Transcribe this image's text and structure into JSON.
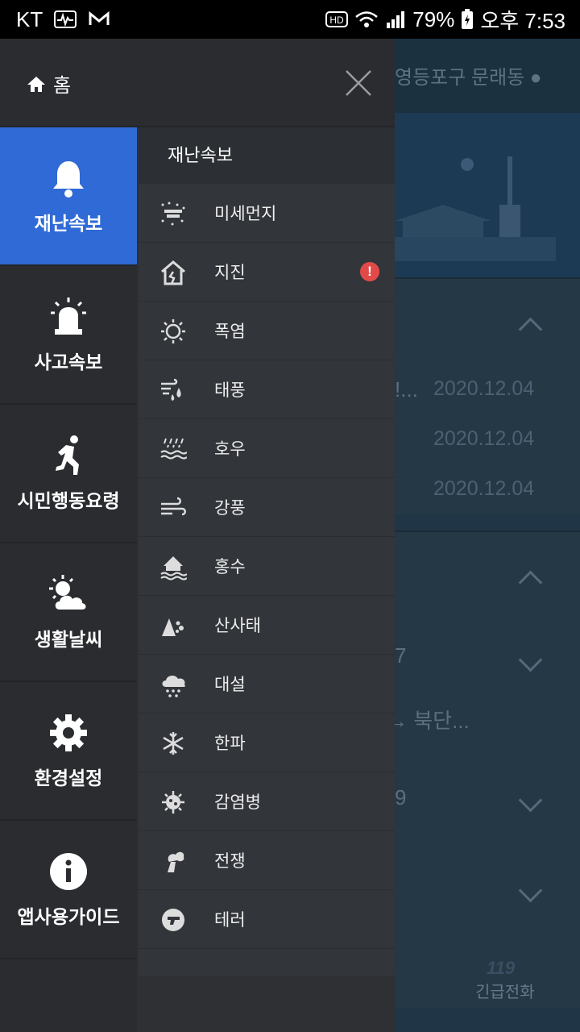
{
  "status_bar": {
    "carrier": "KT",
    "battery": "79%",
    "time": "오후 7:53"
  },
  "background": {
    "location": "영등포구 문래동",
    "dates": [
      "2020.12.04",
      "2020.12.04",
      "2020.12.04"
    ],
    "snippet_1": "!...",
    "snippet_2": "→ 북단...",
    "num_1": "7",
    "num_2": "9",
    "emergency_label": "긴급전화"
  },
  "drawer": {
    "home_label": "홈",
    "categories": [
      {
        "label": "재난속보",
        "icon": "bell-icon"
      },
      {
        "label": "사고속보",
        "icon": "siren-icon"
      },
      {
        "label": "시민행동요령",
        "icon": "running-person-icon"
      },
      {
        "label": "생활날씨",
        "icon": "weather-icon"
      },
      {
        "label": "환경설정",
        "icon": "gear-icon"
      },
      {
        "label": "앱사용가이드",
        "icon": "info-icon"
      }
    ],
    "sub_title": "재난속보",
    "items": [
      {
        "label": "미세먼지",
        "icon": "fine-dust-icon"
      },
      {
        "label": "지진",
        "icon": "earthquake-icon",
        "badge": "!"
      },
      {
        "label": "폭염",
        "icon": "heatwave-icon"
      },
      {
        "label": "태풍",
        "icon": "typhoon-icon"
      },
      {
        "label": "호우",
        "icon": "heavy-rain-icon"
      },
      {
        "label": "강풍",
        "icon": "strong-wind-icon"
      },
      {
        "label": "홍수",
        "icon": "flood-icon"
      },
      {
        "label": "산사태",
        "icon": "landslide-icon"
      },
      {
        "label": "대설",
        "icon": "heavy-snow-icon"
      },
      {
        "label": "한파",
        "icon": "cold-wave-icon"
      },
      {
        "label": "감염병",
        "icon": "infection-icon"
      },
      {
        "label": "전쟁",
        "icon": "war-icon"
      },
      {
        "label": "테러",
        "icon": "terror-icon"
      }
    ]
  },
  "colors": {
    "accent": "#2f6ad6",
    "badge": "#e24a4a"
  }
}
